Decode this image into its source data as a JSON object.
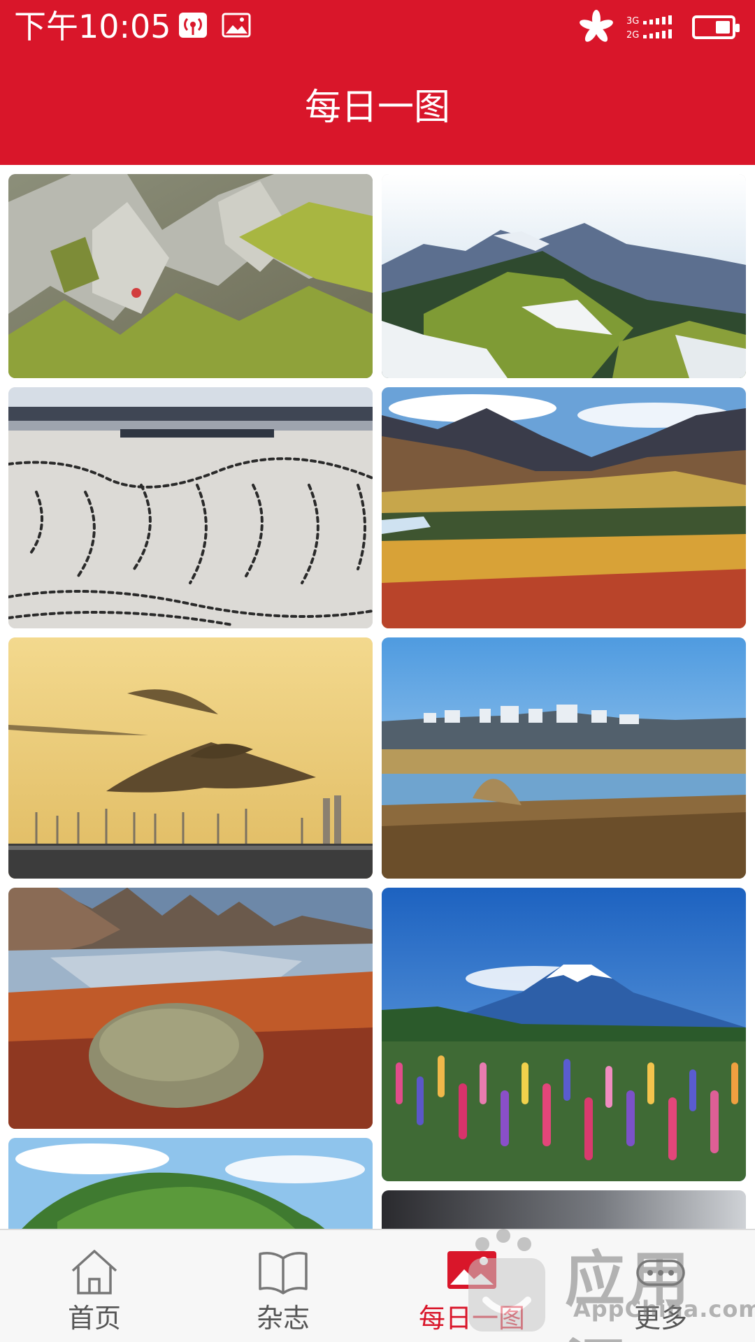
{
  "status": {
    "time": "下午10:05",
    "network": [
      "3G",
      "2G"
    ],
    "icons": [
      "wifi-hotspot-icon",
      "image-icon",
      "hk-flag-icon",
      "signal-icon",
      "battery-icon"
    ]
  },
  "header": {
    "title": "每日一图",
    "background": "#d9162a"
  },
  "tabs": [
    {
      "label": "首页",
      "icon": "home-icon",
      "active": false
    },
    {
      "label": "杂志",
      "icon": "book-icon",
      "active": false
    },
    {
      "label": "每日一图",
      "icon": "picture-icon",
      "active": true
    },
    {
      "label": "更多",
      "icon": "more-icon",
      "active": false
    }
  ],
  "watermark": {
    "title": "应用汇",
    "subtitle": "AppChina.com"
  },
  "colors": {
    "accent": "#d9162a",
    "tab_inactive": "#555555"
  }
}
